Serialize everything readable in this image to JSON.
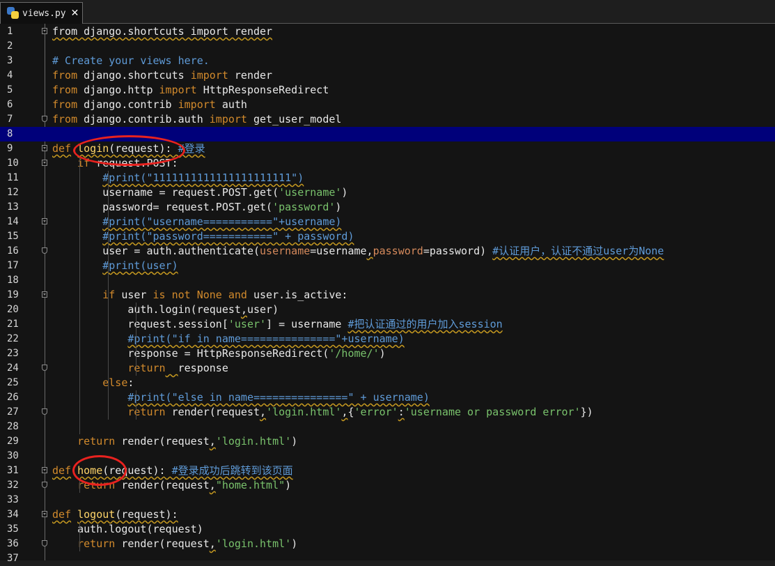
{
  "tab": {
    "title": "views.py",
    "close_symbol": "✕",
    "icon": "python-file-icon"
  },
  "colors": {
    "keyword": "#d28a2c",
    "string": "#79c26c",
    "comment": "#5f9bd8",
    "function": "#ffd56a",
    "current_line": "#00007a",
    "annotation": "#e8221f"
  },
  "editor": {
    "current_line": 8,
    "lines": [
      {
        "n": "1",
        "t": [
          {
            "c": "from django.shortcuts import render",
            "k": "w"
          }
        ]
      },
      {
        "n": "2",
        "t": []
      },
      {
        "n": "3",
        "t": [
          {
            "c": "# Create your views here.",
            "k": "cm"
          }
        ]
      },
      {
        "n": "4",
        "t": [
          {
            "c": "from",
            "k": "kw"
          },
          {
            "c": " django.shortcuts "
          },
          {
            "c": "import",
            "k": "kw"
          },
          {
            "c": " render"
          }
        ]
      },
      {
        "n": "5",
        "t": [
          {
            "c": "from",
            "k": "kw"
          },
          {
            "c": " django.http "
          },
          {
            "c": "import",
            "k": "kw"
          },
          {
            "c": " HttpResponseRedirect"
          }
        ]
      },
      {
        "n": "6",
        "t": [
          {
            "c": "from",
            "k": "kw"
          },
          {
            "c": " django.contrib "
          },
          {
            "c": "import",
            "k": "kw"
          },
          {
            "c": " auth"
          }
        ]
      },
      {
        "n": "7",
        "t": [
          {
            "c": "from",
            "k": "kw"
          },
          {
            "c": " django.contrib.auth "
          },
          {
            "c": "import",
            "k": "kw"
          },
          {
            "c": " get_user_model"
          }
        ]
      },
      {
        "n": "8",
        "t": []
      },
      {
        "n": "9",
        "t": [
          {
            "c": "def",
            "k": "kw w"
          },
          {
            "c": " "
          },
          {
            "c": "login",
            "k": "fn w"
          },
          {
            "c": "(request): ",
            "k": "w"
          },
          {
            "c": "#登录",
            "k": "cm w"
          }
        ]
      },
      {
        "n": "10",
        "t": [
          {
            "c": "    "
          },
          {
            "c": "if",
            "k": "kw"
          },
          {
            "c": " request.POST:"
          }
        ]
      },
      {
        "n": "11",
        "t": [
          {
            "c": "        "
          },
          {
            "c": "#print(\"1111111111111111111111\")",
            "k": "cm w"
          }
        ]
      },
      {
        "n": "12",
        "t": [
          {
            "c": "        username = request.POST.get("
          },
          {
            "c": "'username'",
            "k": "str"
          },
          {
            "c": ")"
          }
        ]
      },
      {
        "n": "13",
        "t": [
          {
            "c": "        password= request.POST.get("
          },
          {
            "c": "'password'",
            "k": "str"
          },
          {
            "c": ")"
          }
        ]
      },
      {
        "n": "14",
        "t": [
          {
            "c": "        "
          },
          {
            "c": "#print(\"username===========\"+username)",
            "k": "cm w"
          }
        ]
      },
      {
        "n": "15",
        "t": [
          {
            "c": "        "
          },
          {
            "c": "#print(\"password===========\" + password)",
            "k": "cm w"
          }
        ]
      },
      {
        "n": "16",
        "t": [
          {
            "c": "        user = auth.authenticate("
          },
          {
            "c": "username",
            "k": "pm"
          },
          {
            "c": "=username"
          },
          {
            "c": ",",
            "k": "w"
          },
          {
            "c": "password",
            "k": "pm"
          },
          {
            "c": "=password) "
          },
          {
            "c": "#认证用户，认证不通过user为None",
            "k": "cm w"
          }
        ]
      },
      {
        "n": "17",
        "t": [
          {
            "c": "        "
          },
          {
            "c": "#print(user)",
            "k": "cm w"
          }
        ]
      },
      {
        "n": "18",
        "t": []
      },
      {
        "n": "19",
        "t": [
          {
            "c": "        "
          },
          {
            "c": "if",
            "k": "kw"
          },
          {
            "c": " user "
          },
          {
            "c": "is not None and",
            "k": "kw"
          },
          {
            "c": " user.is_active:"
          }
        ]
      },
      {
        "n": "20",
        "t": [
          {
            "c": "            auth.login(request"
          },
          {
            "c": ",",
            "k": "w"
          },
          {
            "c": "user)"
          }
        ]
      },
      {
        "n": "21",
        "t": [
          {
            "c": "            request.session["
          },
          {
            "c": "'user'",
            "k": "str"
          },
          {
            "c": "] = username "
          },
          {
            "c": "#把认证通过的用户加入session",
            "k": "cm w"
          }
        ]
      },
      {
        "n": "22",
        "t": [
          {
            "c": "            "
          },
          {
            "c": "#print(\"if in name===============\"+username)",
            "k": "cm w"
          }
        ]
      },
      {
        "n": "23",
        "t": [
          {
            "c": "            response = HttpResponseRedirect("
          },
          {
            "c": "'/home/'",
            "k": "str"
          },
          {
            "c": ")"
          }
        ]
      },
      {
        "n": "24",
        "t": [
          {
            "c": "            "
          },
          {
            "c": "return",
            "k": "kw"
          },
          {
            "c": "  ",
            "k": "w"
          },
          {
            "c": "response"
          }
        ]
      },
      {
        "n": "25",
        "t": [
          {
            "c": "        "
          },
          {
            "c": "else",
            "k": "kw"
          },
          {
            "c": ":"
          }
        ]
      },
      {
        "n": "26",
        "t": [
          {
            "c": "            "
          },
          {
            "c": "#print(\"else in name===============\" + username)",
            "k": "cm w"
          }
        ]
      },
      {
        "n": "27",
        "t": [
          {
            "c": "            "
          },
          {
            "c": "return",
            "k": "kw"
          },
          {
            "c": " render(request"
          },
          {
            "c": ",",
            "k": "w"
          },
          {
            "c": "'login.html'",
            "k": "str"
          },
          {
            "c": ",",
            "k": "w"
          },
          {
            "c": "{"
          },
          {
            "c": "'error'",
            "k": "str"
          },
          {
            "c": ":",
            "k": "w"
          },
          {
            "c": "'username or password error'",
            "k": "str"
          },
          {
            "c": "})"
          }
        ]
      },
      {
        "n": "28",
        "t": []
      },
      {
        "n": "29",
        "t": [
          {
            "c": "    "
          },
          {
            "c": "return",
            "k": "kw"
          },
          {
            "c": " render(request"
          },
          {
            "c": ",",
            "k": "w"
          },
          {
            "c": "'login.html'",
            "k": "str"
          },
          {
            "c": ")"
          }
        ]
      },
      {
        "n": "30",
        "t": []
      },
      {
        "n": "31",
        "t": [
          {
            "c": "def",
            "k": "kw w"
          },
          {
            "c": " "
          },
          {
            "c": "home",
            "k": "fn w"
          },
          {
            "c": "(request): ",
            "k": "w"
          },
          {
            "c": "#登录成功后跳转到该页面",
            "k": "cm w"
          }
        ]
      },
      {
        "n": "32",
        "t": [
          {
            "c": "    "
          },
          {
            "c": "return",
            "k": "kw"
          },
          {
            "c": " render(request"
          },
          {
            "c": ",",
            "k": "w"
          },
          {
            "c": "\"home.html\"",
            "k": "str"
          },
          {
            "c": ")"
          }
        ]
      },
      {
        "n": "33",
        "t": []
      },
      {
        "n": "34",
        "t": [
          {
            "c": "def",
            "k": "kw w"
          },
          {
            "c": " "
          },
          {
            "c": "logout",
            "k": "fn w"
          },
          {
            "c": "(request):",
            "k": "w"
          }
        ]
      },
      {
        "n": "35",
        "t": [
          {
            "c": "    auth.logout(request)"
          }
        ]
      },
      {
        "n": "36",
        "t": [
          {
            "c": "    "
          },
          {
            "c": "return",
            "k": "kw"
          },
          {
            "c": " render(request"
          },
          {
            "c": ",",
            "k": "w"
          },
          {
            "c": "'login.html'",
            "k": "str"
          },
          {
            "c": ")"
          }
        ]
      },
      {
        "n": "37",
        "t": []
      }
    ]
  }
}
